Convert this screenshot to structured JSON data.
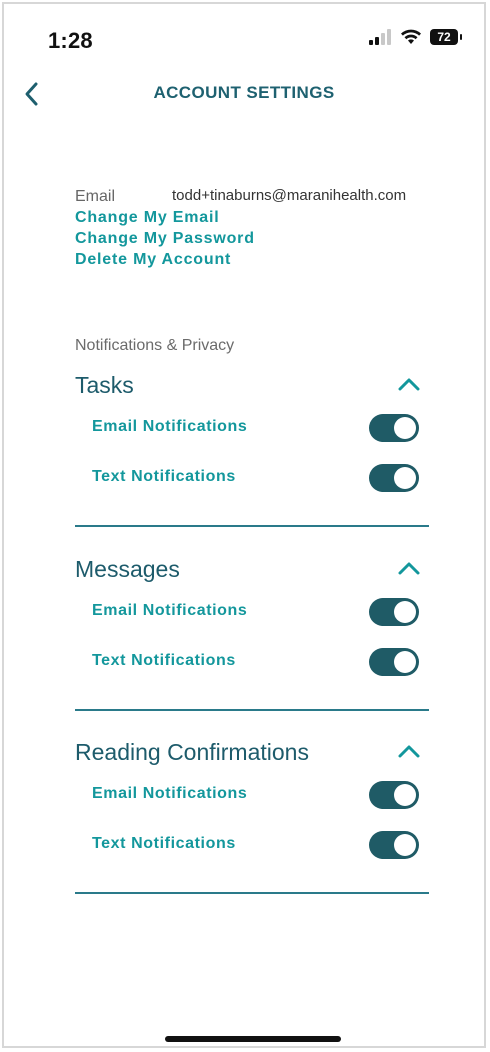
{
  "status_bar": {
    "time": "1:28",
    "battery": "72"
  },
  "header": {
    "title": "ACCOUNT SETTINGS",
    "back_icon": "chevron-left-icon"
  },
  "account": {
    "email_label": "Email",
    "email_value": "todd+tinaburns@maranihealth.com",
    "links": [
      "Change My Email",
      "Change My Password",
      "Delete My Account"
    ]
  },
  "notifications": {
    "section_label": "Notifications & Privacy",
    "groups": [
      {
        "title": "Tasks",
        "expanded": true,
        "rows": [
          {
            "label": "Email Notifications",
            "enabled": true
          },
          {
            "label": "Text Notifications",
            "enabled": true
          }
        ]
      },
      {
        "title": "Messages",
        "expanded": true,
        "rows": [
          {
            "label": "Email Notifications",
            "enabled": true
          },
          {
            "label": "Text Notifications",
            "enabled": true
          }
        ]
      },
      {
        "title": "Reading Confirmations",
        "expanded": true,
        "rows": [
          {
            "label": "Email Notifications",
            "enabled": true
          },
          {
            "label": "Text Notifications",
            "enabled": true
          }
        ]
      }
    ]
  },
  "colors": {
    "accent": "#13979c",
    "title": "#1e6170",
    "toggle_on": "#1f5b66",
    "divider": "#2a7a8a"
  }
}
